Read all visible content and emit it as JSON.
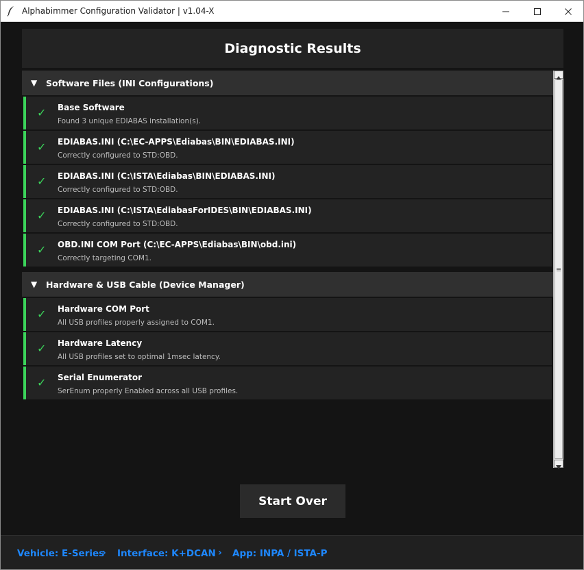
{
  "window": {
    "title": "Alphabimmer Configuration Validator | v1.04-X",
    "app_icon": "feather-icon"
  },
  "header": {
    "title": "Diagnostic Results"
  },
  "sections": [
    {
      "title": "Software Files (INI Configurations)",
      "expanded": true,
      "items": [
        {
          "status": "pass",
          "title": "Base Software",
          "description": "Found 3 unique EDIABAS installation(s)."
        },
        {
          "status": "pass",
          "title": "EDIABAS.INI (C:\\EC-APPS\\Ediabas\\BIN\\EDIABAS.INI)",
          "description": "Correctly configured to STD:OBD."
        },
        {
          "status": "pass",
          "title": "EDIABAS.INI (C:\\ISTA\\Ediabas\\BIN\\EDIABAS.INI)",
          "description": "Correctly configured to STD:OBD."
        },
        {
          "status": "pass",
          "title": "EDIABAS.INI (C:\\ISTA\\EdiabasForIDES\\BIN\\EDIABAS.INI)",
          "description": "Correctly configured to STD:OBD."
        },
        {
          "status": "pass",
          "title": "OBD.INI COM Port (C:\\EC-APPS\\Ediabas\\BIN\\obd.ini)",
          "description": "Correctly targeting COM1."
        }
      ]
    },
    {
      "title": "Hardware & USB Cable (Device Manager)",
      "expanded": true,
      "items": [
        {
          "status": "pass",
          "title": "Hardware COM Port",
          "description": "All USB profiles properly assigned to COM1."
        },
        {
          "status": "pass",
          "title": "Hardware Latency",
          "description": "All USB profiles set to optimal 1msec latency."
        },
        {
          "status": "pass",
          "title": "Serial Enumerator",
          "description": "SerEnum properly Enabled across all USB profiles."
        }
      ]
    }
  ],
  "symbols": {
    "check": "✓",
    "expanded_arrow": "▼",
    "breadcrumb_separator": "›"
  },
  "actions": {
    "start_over_label": "Start Over"
  },
  "breadcrumb": [
    "Vehicle: E-Series",
    "Interface: K+DCAN",
    "App: INPA / ISTA-P"
  ],
  "colors": {
    "success": "#3bd35a",
    "accent_link": "#1e88ff",
    "background": "#141414",
    "card": "#232323",
    "section_header": "#303030"
  }
}
